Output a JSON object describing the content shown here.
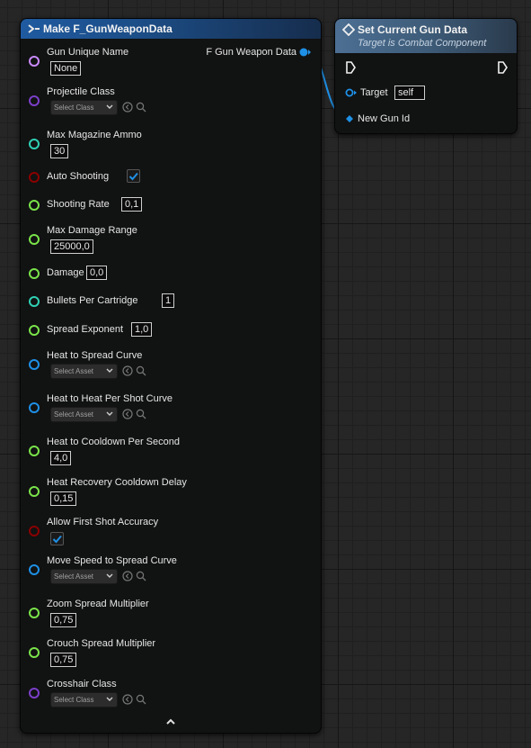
{
  "make_node": {
    "title": "Make F_GunWeaponData",
    "output_label": "F Gun Weapon Data",
    "fields": [
      {
        "label": "Gun Unique Name",
        "kind": "text",
        "value": "None",
        "pin_color": "#c98aff"
      },
      {
        "label": "Projectile Class",
        "kind": "select",
        "value": "Select Class",
        "pin_color": "#7b3fc9"
      },
      {
        "label": "Max Magazine Ammo",
        "kind": "text",
        "value": "30",
        "pin_color": "#2fd1b4"
      },
      {
        "label": "Auto Shooting",
        "kind": "checkbox",
        "value": "true",
        "pin_color": "#8a0000"
      },
      {
        "label": "Shooting Rate",
        "kind": "inline",
        "value": "0,1",
        "pin_color": "#7ae34a"
      },
      {
        "label": "Max Damage Range",
        "kind": "text",
        "value": "25000,0",
        "pin_color": "#7ae34a"
      },
      {
        "label": "Damage",
        "kind": "inline",
        "value": "0,0",
        "pin_color": "#7ae34a"
      },
      {
        "label": "Bullets Per Cartridge",
        "kind": "inline",
        "value": "1",
        "pin_color": "#2fd1b4"
      },
      {
        "label": "Spread Exponent",
        "kind": "inline",
        "value": "1,0",
        "pin_color": "#7ae34a"
      },
      {
        "label": "Heat to Spread Curve",
        "kind": "select",
        "value": "Select Asset",
        "pin_color": "#1e90e6"
      },
      {
        "label": "Heat to Heat Per Shot Curve",
        "kind": "select",
        "value": "Select Asset",
        "pin_color": "#1e90e6"
      },
      {
        "label": "Heat to Cooldown Per Second",
        "kind": "text",
        "value": "4,0",
        "pin_color": "#7ae34a"
      },
      {
        "label": "Heat Recovery Cooldown Delay",
        "kind": "text",
        "value": "0,15",
        "pin_color": "#7ae34a"
      },
      {
        "label": "Allow First Shot Accuracy",
        "kind": "checkbox",
        "value": "true",
        "pin_color": "#8a0000"
      },
      {
        "label": "Move Speed to Spread Curve",
        "kind": "select",
        "value": "Select Asset",
        "pin_color": "#1e90e6"
      },
      {
        "label": "Zoom Spread Multiplier",
        "kind": "text",
        "value": "0,75",
        "pin_color": "#7ae34a"
      },
      {
        "label": "Crouch Spread Multiplier",
        "kind": "text",
        "value": "0,75",
        "pin_color": "#7ae34a"
      },
      {
        "label": "Crosshair Class",
        "kind": "select",
        "value": "Select Class",
        "pin_color": "#7b3fc9"
      }
    ]
  },
  "set_node": {
    "title": "Set Current Gun Data",
    "subtitle": "Target is Combat Component",
    "target_label": "Target",
    "target_value": "self",
    "new_gun_id_label": "New Gun Id"
  },
  "colors": {
    "wire": "#1e90e6",
    "exec": "#f0f0f0",
    "struct_pin": "#1e90e6",
    "check": "#1e90e6"
  }
}
